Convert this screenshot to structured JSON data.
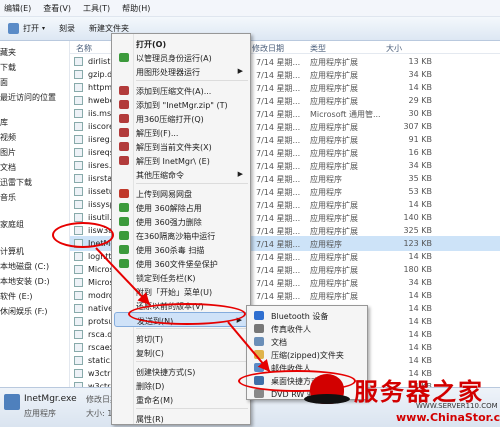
{
  "menubar": {
    "items": [
      "编辑(E)",
      "查看(V)",
      "工具(T)",
      "帮助(H)"
    ]
  },
  "toolbar": {
    "open": "打开",
    "burn": "刻录",
    "new_folder": "新建文件夹"
  },
  "nav": {
    "items": [
      "藏夹",
      "下载",
      "面",
      "最近访问的位置",
      "库",
      "视频",
      "图片",
      "文档",
      "迅雷下载",
      "音乐",
      "家庭组",
      "计算机",
      "本地磁盘 (C:)",
      "本地安装 (D:)",
      "软件 (E:)",
      "休闲娱乐 (F:)"
    ]
  },
  "columns": {
    "name": "名称",
    "date": "修改日期",
    "type": "类型",
    "size": "大小"
  },
  "files": [
    {
      "name": "dirlist.dll",
      "type": "应用程序扩展",
      "size": "13 KB"
    },
    {
      "name": "gzip.dll",
      "type": "应用程序扩展",
      "size": "34 KB"
    },
    {
      "name": "httpmib.dll",
      "type": "应用程序扩展",
      "size": "14 KB"
    },
    {
      "name": "hwebcore.dll",
      "type": "应用程序扩展",
      "size": "29 KB"
    },
    {
      "name": "iis.msc",
      "type": "Microsoft 通用管...",
      "size": "30 KB"
    },
    {
      "name": "iiscore.dll",
      "type": "应用程序扩展",
      "size": "307 KB"
    },
    {
      "name": "iisreg.dll",
      "type": "应用程序扩展",
      "size": "91 KB"
    },
    {
      "name": "iisreqs.dll",
      "type": "应用程序扩展",
      "size": "16 KB"
    },
    {
      "name": "iisres.dll",
      "type": "应用程序扩展",
      "size": "34 KB"
    },
    {
      "name": "iisrstas.exe",
      "type": "应用程序",
      "size": "35 KB"
    },
    {
      "name": "iissetup.exe",
      "type": "应用程序",
      "size": "53 KB"
    },
    {
      "name": "iissyspr.dll",
      "type": "应用程序扩展",
      "size": "14 KB"
    },
    {
      "name": "iisutil.dll",
      "type": "应用程序扩展",
      "size": "140 KB"
    },
    {
      "name": "iisw3adm.dll",
      "type": "应用程序扩展",
      "size": "325 KB"
    },
    {
      "name": "InetMgr.exe",
      "type": "应用程序",
      "size": "123 KB"
    },
    {
      "name": "loghttp.dll",
      "type": "应用程序扩展",
      "size": "14 KB"
    },
    {
      "name": "Microsoft.Web...",
      "type": "应用程序扩展",
      "size": "180 KB"
    },
    {
      "name": "Microsoft.Web...",
      "type": "应用程序扩展",
      "size": "34 KB"
    },
    {
      "name": "modrqflt.dll",
      "type": "应用程序扩展",
      "size": "14 KB"
    },
    {
      "name": "nativerd.dll",
      "type": "应用程序扩展",
      "size": "14 KB"
    },
    {
      "name": "protsup.dll",
      "type": "应用程序扩展",
      "size": "14 KB"
    },
    {
      "name": "rsca.dll",
      "type": "应用程序扩展",
      "size": "14 KB"
    },
    {
      "name": "rscaext.dll",
      "type": "应用程序扩展",
      "size": "14 KB"
    },
    {
      "name": "static.dll",
      "type": "应用程序扩展",
      "size": "14 KB"
    },
    {
      "name": "w3ctrlps.dll",
      "type": "应用程序扩展",
      "size": "14 KB"
    },
    {
      "name": "w3ctrs.dll",
      "type": "应用程序扩展",
      "size": "14 KB"
    }
  ],
  "date_prefix": "7/14 星期...",
  "context_menu": {
    "items": [
      "打开(O)",
      "以管理员身份运行(A)",
      "用图形处理器运行",
      "添加到压缩文件(A)...",
      "添加到 \"InetMgr.zip\" (T)",
      "用360压缩打开(Q)",
      "解压到(F)...",
      "解压到当前文件夹(X)",
      "解压到 InetMgr\\ (E)",
      "其他压缩命令",
      "上传到网易网盘",
      "使用 360解除占用",
      "使用 360强力删除",
      "在360隔离沙箱中运行",
      "使用 360杀毒 扫描",
      "使用 360文件堡垒保护",
      "锁定到任务栏(K)",
      "附到「开始」菜单(U)",
      "还原以前的版本(V)",
      "发送到(N)",
      "剪切(T)",
      "复制(C)",
      "创建快捷方式(S)",
      "删除(D)",
      "重命名(M)",
      "属性(R)"
    ]
  },
  "send_to": {
    "items": [
      "Bluetooth 设备",
      "传真收件人",
      "文档",
      "压缩(zipped)文件夹",
      "邮件收件人",
      "桌面快捷方式",
      "DVD RW 驱动器"
    ]
  },
  "status": {
    "name": "InetMgr.exe",
    "type": "应用程序",
    "modified_label": "修改日期: 200",
    "size_label": "大小: 122"
  },
  "watermark": {
    "title": "服务器之家",
    "url": "WWW.SERVER110.COM",
    "site": "www.ChinaStor.com"
  },
  "colors": {
    "highlight": "#cfe2f8",
    "annotation": "#e60000",
    "brand_red": "#d20000"
  }
}
